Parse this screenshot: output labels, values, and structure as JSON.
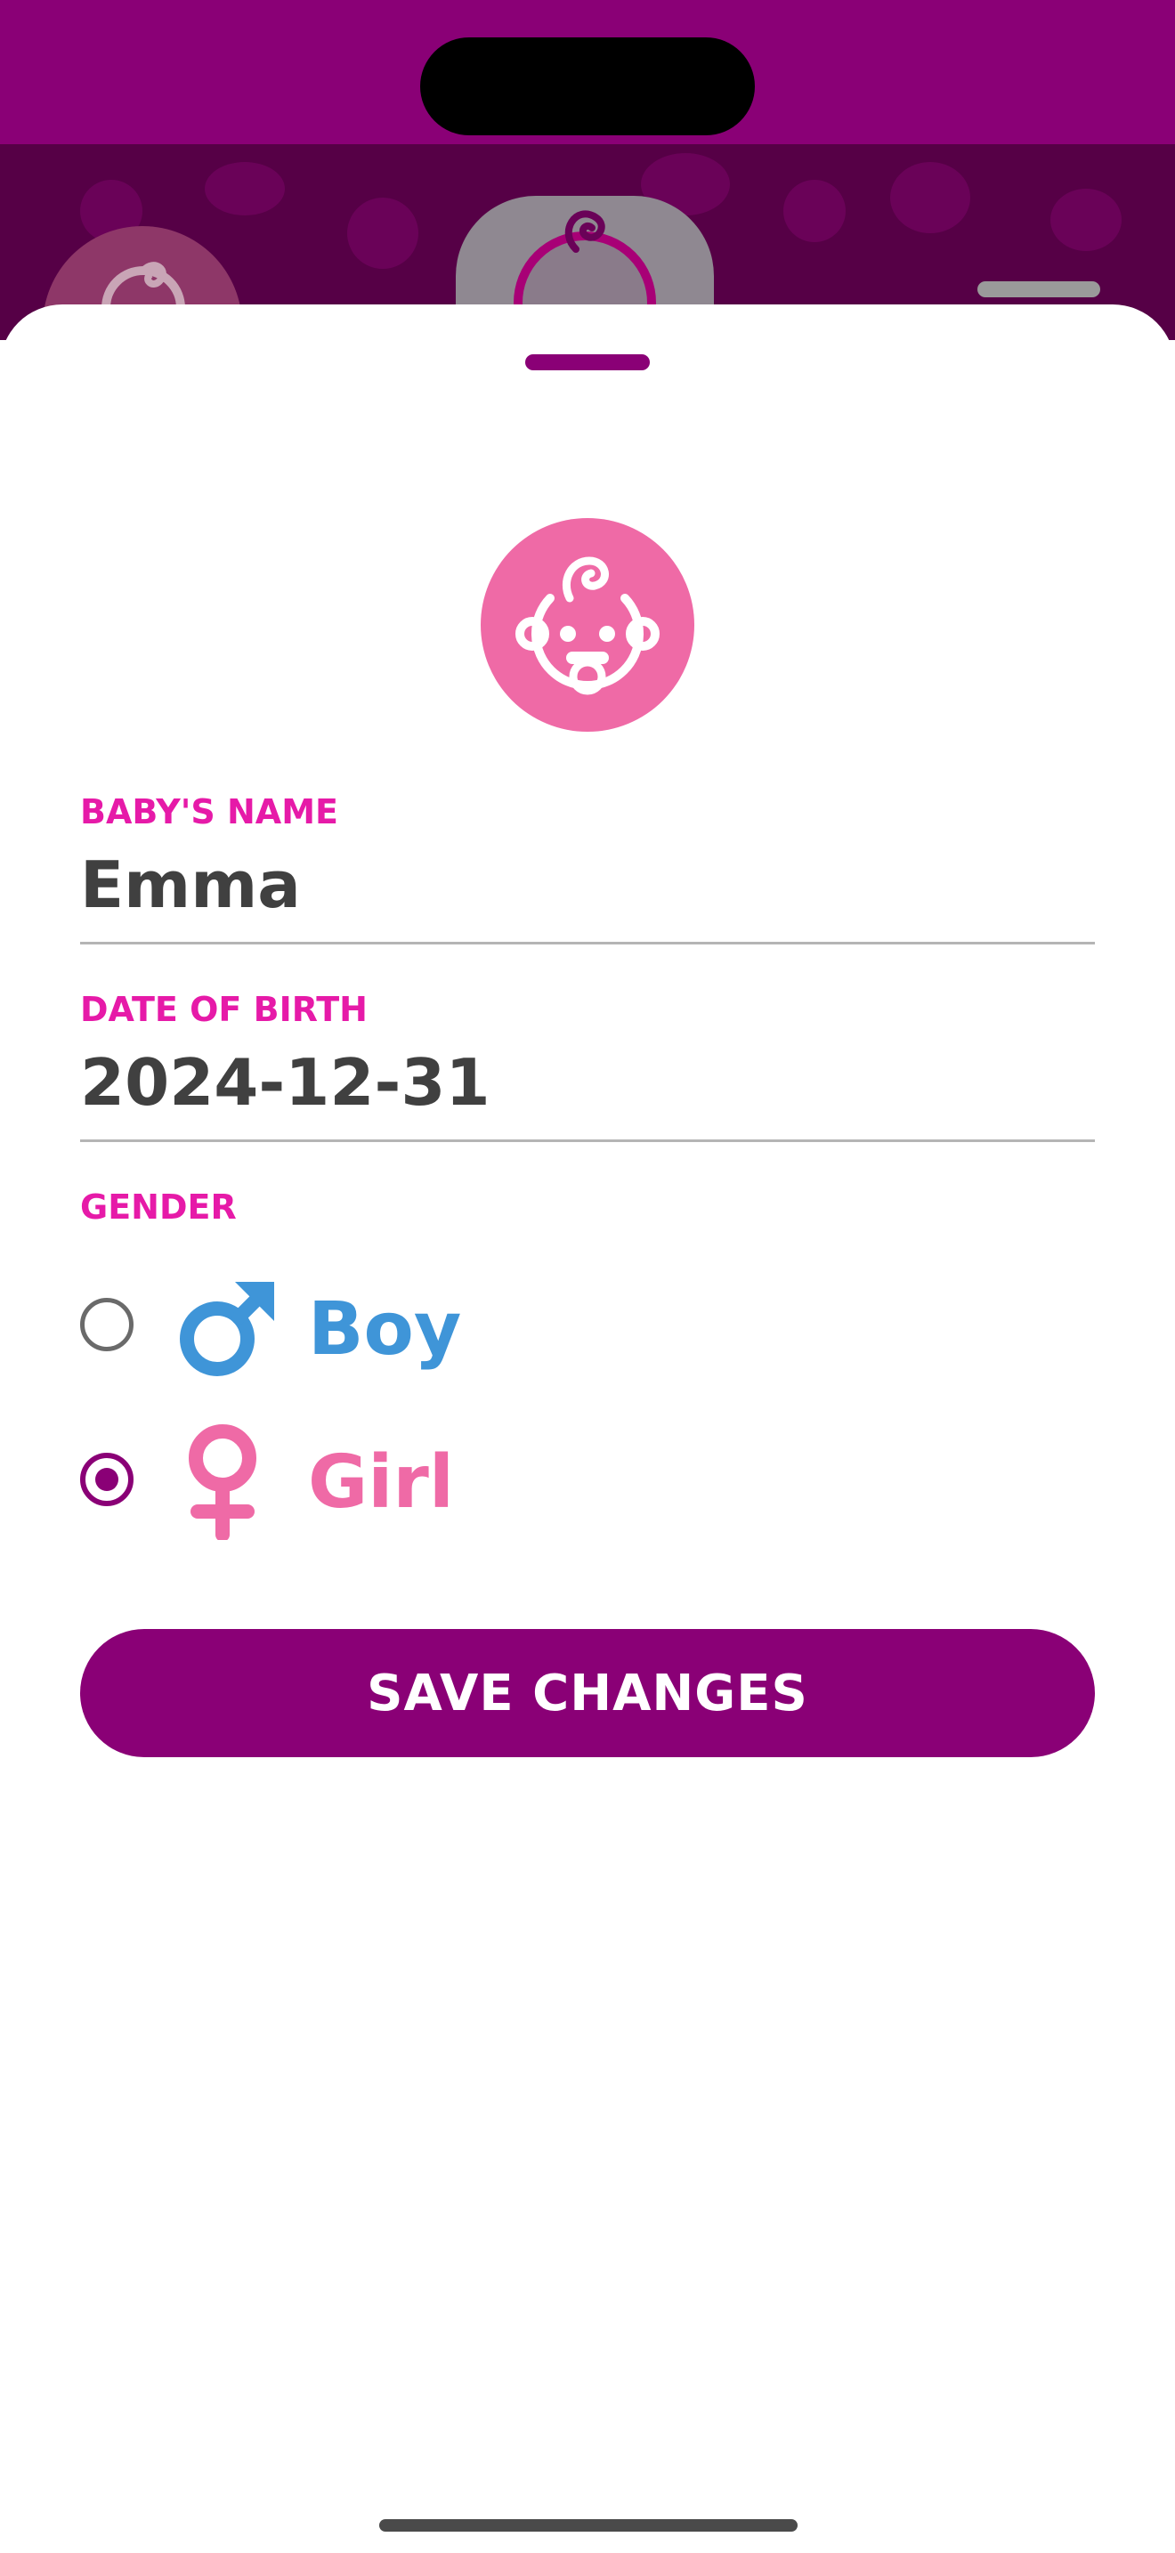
{
  "form": {
    "name_label": "BABY'S NAME",
    "name_value": "Emma",
    "dob_label": "DATE OF BIRTH",
    "dob_value": "2024-12-31",
    "gender_label": "GENDER",
    "gender_options": [
      {
        "label": "Boy",
        "selected": false,
        "color": "#3f95d8",
        "icon": "male-symbol-icon"
      },
      {
        "label": "Girl",
        "selected": true,
        "color": "#ef6aa6",
        "icon": "female-symbol-icon"
      }
    ]
  },
  "save_button_label": "SAVE CHANGES",
  "colors": {
    "primary": "#8a0076",
    "label_pink": "#e61aa8",
    "avatar_pink": "#ef6aa6",
    "boy_blue": "#3f95d8"
  },
  "icons": {
    "avatar": "baby-face-icon"
  }
}
